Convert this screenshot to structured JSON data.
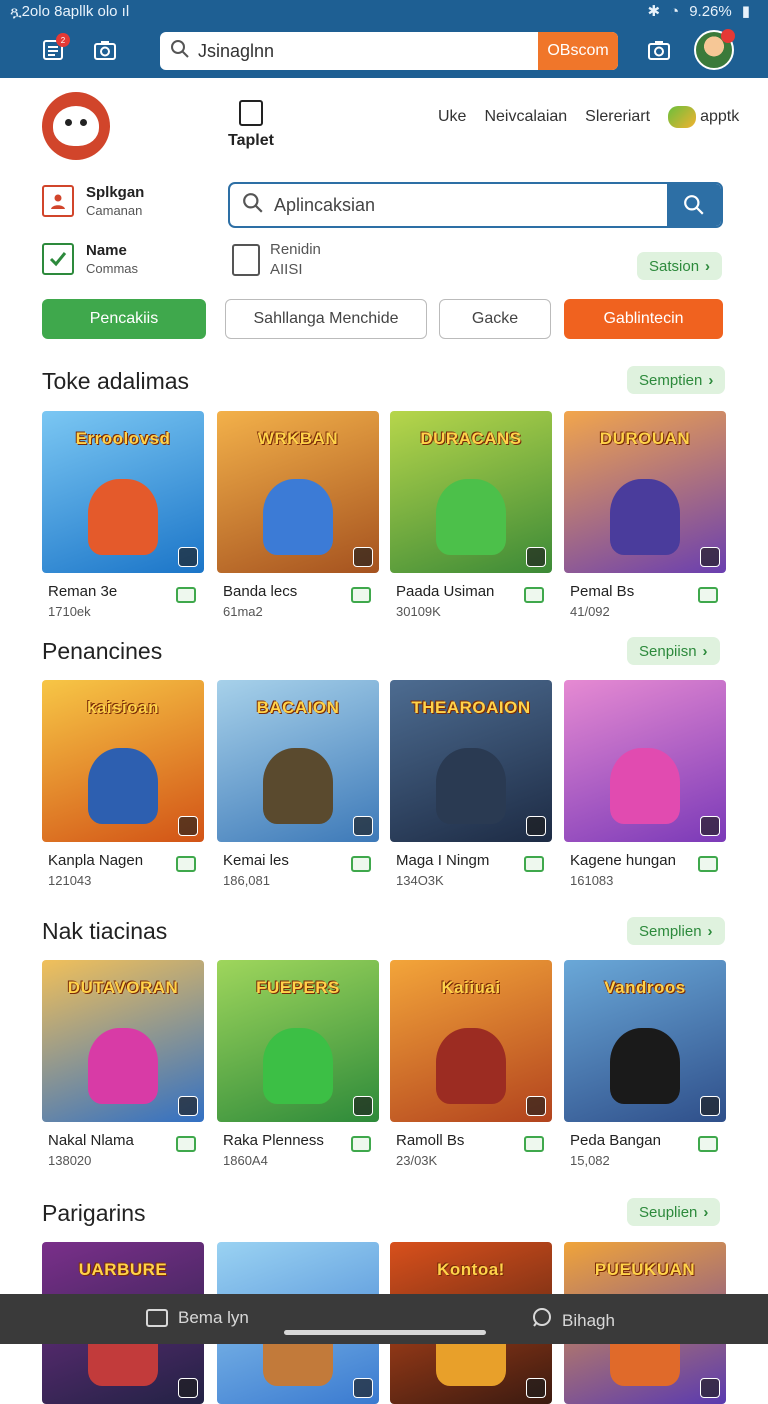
{
  "status_bar": {
    "left_text": "ጿ2olo 8apllk olo ıl",
    "right_text": "9.26%"
  },
  "toolbar": {
    "search_value": "Jsinaglnn",
    "search_button": "OBscom",
    "notification_badge": "2"
  },
  "header": {
    "tablet_label": "Taplet",
    "nav": [
      "Uke",
      "Neivcalaian",
      "Slereriart"
    ],
    "apk_label": "apptk"
  },
  "accounts": [
    {
      "title": "Splkgan",
      "subtitle": "Camanan"
    },
    {
      "title": "Name",
      "subtitle": "Commas"
    }
  ],
  "main_search": {
    "placeholder": "Aplincaksian"
  },
  "renid": {
    "line1": "Renidin",
    "line2": "AIISI"
  },
  "satsion_pill": "Satsion",
  "buttons": [
    "Pencakiis",
    "Sahllanga Menchide",
    "Gacke",
    "Gablintecin"
  ],
  "sections": [
    {
      "title": "Toke adalimas",
      "more": "Semptien",
      "items": [
        {
          "name": "Reman 3e",
          "count": "1710ek",
          "art": "Erroolovsd",
          "c1": "#1b75c8",
          "c2": "#7bc7f3",
          "hero": "#e45a2b"
        },
        {
          "name": "Banda lecs",
          "count": "61ma2",
          "art": "WRKBAN",
          "c1": "#a5521f",
          "c2": "#f3b14a",
          "hero": "#3c7bd6"
        },
        {
          "name": "Paada Usiman",
          "count": "30109K",
          "art": "DURACANS",
          "c1": "#3c8a37",
          "c2": "#b7d64b",
          "hero": "#4cc04a"
        },
        {
          "name": "Pemal Bs",
          "count": "41/092",
          "art": "DUROUAN",
          "c1": "#6a3fb0",
          "c2": "#f2a64c",
          "hero": "#4a3c9c"
        }
      ]
    },
    {
      "title": "Penancines",
      "more": "Senpiisn",
      "items": [
        {
          "name": "Kanpla Nagen",
          "count": "121043",
          "art": "kaisioan",
          "c1": "#d25316",
          "c2": "#f7c646",
          "hero": "#2d5fb0"
        },
        {
          "name": "Kemai les",
          "count": "186,081",
          "art": "BACAION",
          "c1": "#3d79b8",
          "c2": "#a7d1ea",
          "hero": "#5a4a2e"
        },
        {
          "name": "Maga I Ningm",
          "count": "134O3K",
          "art": "THEAROAION",
          "c1": "#1d2b44",
          "c2": "#4d6c91",
          "hero": "#2a3a52"
        },
        {
          "name": "Kagene hungan",
          "count": "161083",
          "art": "",
          "c1": "#7b3ab8",
          "c2": "#e68ad2",
          "hero": "#e14bb0"
        }
      ]
    },
    {
      "title": "Nak tiacinas",
      "more": "Semplien",
      "items": [
        {
          "name": "Nakal Nlama",
          "count": "138020",
          "art": "DUTAVORAN",
          "c1": "#3270c4",
          "c2": "#f1c05a",
          "hero": "#d83ba6"
        },
        {
          "name": "Raka Plenness",
          "count": "1860A4",
          "art": "FUEPERS",
          "c1": "#2d8a3a",
          "c2": "#9fd65c",
          "hero": "#3cbf45"
        },
        {
          "name": "Ramoll Bs",
          "count": "23/03K",
          "art": "Kaiiuai",
          "c1": "#b2431e",
          "c2": "#f3a53a",
          "hero": "#9c2c22"
        },
        {
          "name": "Peda Bangan",
          "count": "15,082",
          "art": "Vandroos",
          "c1": "#2f4f8a",
          "c2": "#6aa8d8",
          "hero": "#1a1a1a"
        }
      ]
    },
    {
      "title": "Parigarins",
      "more": "Seuplien",
      "items": [
        {
          "name": "",
          "count": "",
          "art": "UARBURE",
          "c1": "#222244",
          "c2": "#7a2f8a",
          "hero": "#c23b3b"
        },
        {
          "name": "",
          "count": "",
          "art": "",
          "c1": "#3a7ad0",
          "c2": "#9ad2f2",
          "hero": "#c27a3a"
        },
        {
          "name": "",
          "count": "",
          "art": "Kontoa!",
          "c1": "#3a1a10",
          "c2": "#d8501c",
          "hero": "#e8a02a"
        },
        {
          "name": "",
          "count": "",
          "art": "PUEUKUAN",
          "c1": "#5a3ab0",
          "c2": "#f0a43a",
          "hero": "#e06a2a"
        }
      ]
    }
  ],
  "bottom_bar": {
    "left": "Bema lyn",
    "right": "Bihagh"
  }
}
